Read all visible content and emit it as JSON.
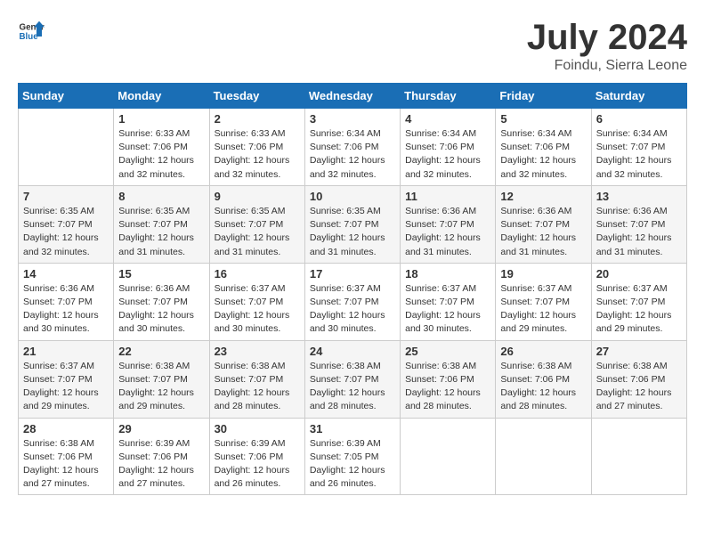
{
  "header": {
    "logo_general": "General",
    "logo_blue": "Blue",
    "title": "July 2024",
    "subtitle": "Foindu, Sierra Leone"
  },
  "columns": [
    "Sunday",
    "Monday",
    "Tuesday",
    "Wednesday",
    "Thursday",
    "Friday",
    "Saturday"
  ],
  "weeks": [
    [
      {
        "day": "",
        "info": ""
      },
      {
        "day": "1",
        "info": "Sunrise: 6:33 AM\nSunset: 7:06 PM\nDaylight: 12 hours\nand 32 minutes."
      },
      {
        "day": "2",
        "info": "Sunrise: 6:33 AM\nSunset: 7:06 PM\nDaylight: 12 hours\nand 32 minutes."
      },
      {
        "day": "3",
        "info": "Sunrise: 6:34 AM\nSunset: 7:06 PM\nDaylight: 12 hours\nand 32 minutes."
      },
      {
        "day": "4",
        "info": "Sunrise: 6:34 AM\nSunset: 7:06 PM\nDaylight: 12 hours\nand 32 minutes."
      },
      {
        "day": "5",
        "info": "Sunrise: 6:34 AM\nSunset: 7:06 PM\nDaylight: 12 hours\nand 32 minutes."
      },
      {
        "day": "6",
        "info": "Sunrise: 6:34 AM\nSunset: 7:07 PM\nDaylight: 12 hours\nand 32 minutes."
      }
    ],
    [
      {
        "day": "7",
        "info": "Sunrise: 6:35 AM\nSunset: 7:07 PM\nDaylight: 12 hours\nand 32 minutes."
      },
      {
        "day": "8",
        "info": "Sunrise: 6:35 AM\nSunset: 7:07 PM\nDaylight: 12 hours\nand 31 minutes."
      },
      {
        "day": "9",
        "info": "Sunrise: 6:35 AM\nSunset: 7:07 PM\nDaylight: 12 hours\nand 31 minutes."
      },
      {
        "day": "10",
        "info": "Sunrise: 6:35 AM\nSunset: 7:07 PM\nDaylight: 12 hours\nand 31 minutes."
      },
      {
        "day": "11",
        "info": "Sunrise: 6:36 AM\nSunset: 7:07 PM\nDaylight: 12 hours\nand 31 minutes."
      },
      {
        "day": "12",
        "info": "Sunrise: 6:36 AM\nSunset: 7:07 PM\nDaylight: 12 hours\nand 31 minutes."
      },
      {
        "day": "13",
        "info": "Sunrise: 6:36 AM\nSunset: 7:07 PM\nDaylight: 12 hours\nand 31 minutes."
      }
    ],
    [
      {
        "day": "14",
        "info": "Sunrise: 6:36 AM\nSunset: 7:07 PM\nDaylight: 12 hours\nand 30 minutes."
      },
      {
        "day": "15",
        "info": "Sunrise: 6:36 AM\nSunset: 7:07 PM\nDaylight: 12 hours\nand 30 minutes."
      },
      {
        "day": "16",
        "info": "Sunrise: 6:37 AM\nSunset: 7:07 PM\nDaylight: 12 hours\nand 30 minutes."
      },
      {
        "day": "17",
        "info": "Sunrise: 6:37 AM\nSunset: 7:07 PM\nDaylight: 12 hours\nand 30 minutes."
      },
      {
        "day": "18",
        "info": "Sunrise: 6:37 AM\nSunset: 7:07 PM\nDaylight: 12 hours\nand 30 minutes."
      },
      {
        "day": "19",
        "info": "Sunrise: 6:37 AM\nSunset: 7:07 PM\nDaylight: 12 hours\nand 29 minutes."
      },
      {
        "day": "20",
        "info": "Sunrise: 6:37 AM\nSunset: 7:07 PM\nDaylight: 12 hours\nand 29 minutes."
      }
    ],
    [
      {
        "day": "21",
        "info": "Sunrise: 6:37 AM\nSunset: 7:07 PM\nDaylight: 12 hours\nand 29 minutes."
      },
      {
        "day": "22",
        "info": "Sunrise: 6:38 AM\nSunset: 7:07 PM\nDaylight: 12 hours\nand 29 minutes."
      },
      {
        "day": "23",
        "info": "Sunrise: 6:38 AM\nSunset: 7:07 PM\nDaylight: 12 hours\nand 28 minutes."
      },
      {
        "day": "24",
        "info": "Sunrise: 6:38 AM\nSunset: 7:07 PM\nDaylight: 12 hours\nand 28 minutes."
      },
      {
        "day": "25",
        "info": "Sunrise: 6:38 AM\nSunset: 7:06 PM\nDaylight: 12 hours\nand 28 minutes."
      },
      {
        "day": "26",
        "info": "Sunrise: 6:38 AM\nSunset: 7:06 PM\nDaylight: 12 hours\nand 28 minutes."
      },
      {
        "day": "27",
        "info": "Sunrise: 6:38 AM\nSunset: 7:06 PM\nDaylight: 12 hours\nand 27 minutes."
      }
    ],
    [
      {
        "day": "28",
        "info": "Sunrise: 6:38 AM\nSunset: 7:06 PM\nDaylight: 12 hours\nand 27 minutes."
      },
      {
        "day": "29",
        "info": "Sunrise: 6:39 AM\nSunset: 7:06 PM\nDaylight: 12 hours\nand 27 minutes."
      },
      {
        "day": "30",
        "info": "Sunrise: 6:39 AM\nSunset: 7:06 PM\nDaylight: 12 hours\nand 26 minutes."
      },
      {
        "day": "31",
        "info": "Sunrise: 6:39 AM\nSunset: 7:05 PM\nDaylight: 12 hours\nand 26 minutes."
      },
      {
        "day": "",
        "info": ""
      },
      {
        "day": "",
        "info": ""
      },
      {
        "day": "",
        "info": ""
      }
    ]
  ]
}
